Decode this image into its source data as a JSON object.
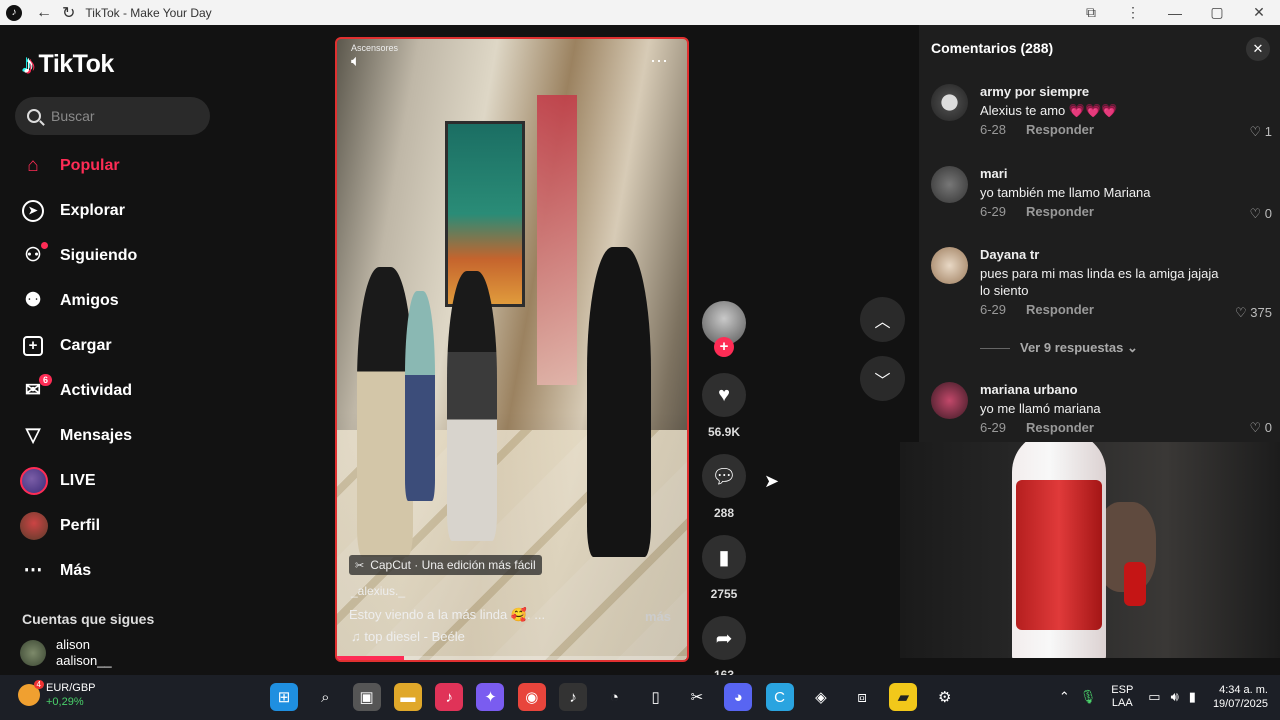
{
  "window": {
    "title": "TikTok - Make Your Day"
  },
  "sidebar": {
    "logo": "TikTok",
    "search_placeholder": "Buscar",
    "items": [
      {
        "label": "Popular",
        "icon": "home-icon"
      },
      {
        "label": "Explorar",
        "icon": "compass-icon"
      },
      {
        "label": "Siguiendo",
        "icon": "following-icon"
      },
      {
        "label": "Amigos",
        "icon": "friends-icon"
      },
      {
        "label": "Cargar",
        "icon": "upload-icon"
      },
      {
        "label": "Actividad",
        "icon": "activity-icon",
        "badge": "6"
      },
      {
        "label": "Mensajes",
        "icon": "messages-icon"
      },
      {
        "label": "LIVE",
        "icon": "live-avatar"
      },
      {
        "label": "Perfil",
        "icon": "profile-avatar"
      },
      {
        "label": "Más",
        "icon": "more-icon"
      }
    ],
    "following_heading": "Cuentas que sigues",
    "following": [
      {
        "name": "alison",
        "handle": "aalison__"
      }
    ]
  },
  "video": {
    "overlay_text": "Ascensores",
    "capcut_label": "CapCut · Una edición más fácil",
    "author": "_alexius._",
    "caption": "Estoy viendo a la más linda 🥰. ...",
    "more_label": "más",
    "music": "♫ top diesel - Beéle",
    "progress_fraction": 0.19
  },
  "actions": {
    "likes": "56.9K",
    "comments": "288",
    "saves": "2755",
    "shares": "163"
  },
  "comments_panel": {
    "heading": "Comentarios (288)",
    "view_replies": "Ver 9 respuestas",
    "items": [
      {
        "user": "army por siempre",
        "text": "Alexius te amo 💗💗💗",
        "date": "6-28",
        "reply": "Responder",
        "likes": "1"
      },
      {
        "user": "mari",
        "text": "yo también me llamo Mariana",
        "date": "6-29",
        "reply": "Responder",
        "likes": "0"
      },
      {
        "user": "Dayana tr",
        "text": "pues para mi mas linda es la amiga jajaja lo siento",
        "date": "6-29",
        "reply": "Responder",
        "likes": "375"
      },
      {
        "user": "mariana urbano",
        "text": "yo me llamó mariana",
        "date": "6-29",
        "reply": "Responder",
        "likes": "0"
      }
    ]
  },
  "taskbar": {
    "ticker": "EUR/GBP",
    "ticker_change": "+0,29%",
    "ticker_badge": "4",
    "lang_top": "ESP",
    "lang_bottom": "LAA",
    "time": "4:34 a. m.",
    "date": "19/07/2025"
  },
  "colors": {
    "accent": "#fe2c55",
    "background": "#121212",
    "panel": "#1e1e1e"
  }
}
